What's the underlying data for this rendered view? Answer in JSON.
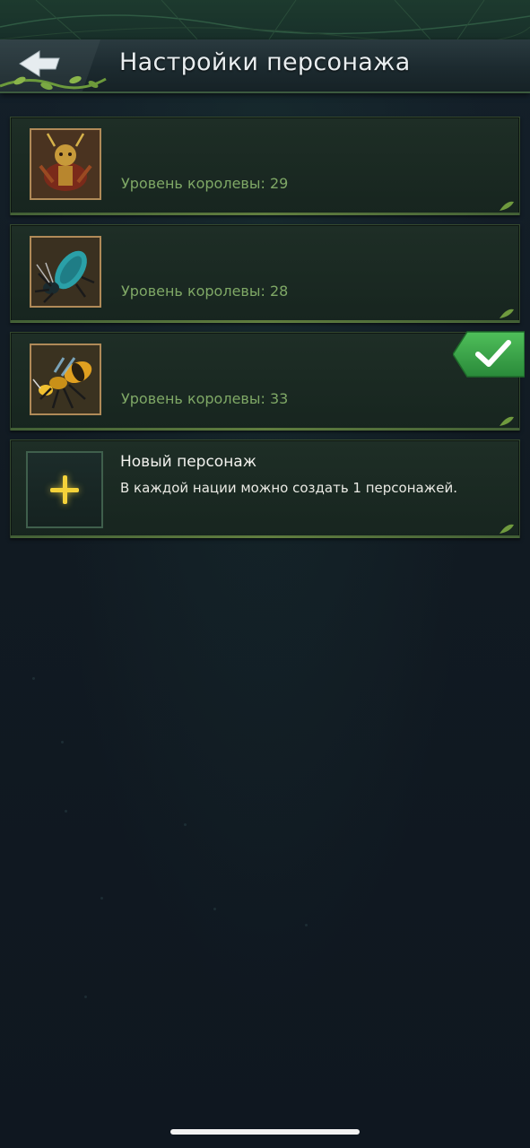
{
  "header": {
    "title": "Настройки персонажа",
    "back_icon": "back-arrow-icon"
  },
  "characters": [
    {
      "avatar": "warrior-ant-portrait",
      "queen_level": "Уровень королевы: 29",
      "selected": false
    },
    {
      "avatar": "blue-beetle-ant-portrait",
      "queen_level": "Уровень королевы: 28",
      "selected": false
    },
    {
      "avatar": "yellow-wasp-ant-portrait",
      "queen_level": "Уровень королевы: 33",
      "selected": true
    }
  ],
  "new_character": {
    "title": "Новый персонаж",
    "description": "В каждой нации можно создать 1 персонажей.",
    "icon": "plus-icon"
  },
  "colors": {
    "accent_green": "#7fa866",
    "selected_badge": "#3ca64a",
    "plus_yellow": "#f4d23a"
  }
}
